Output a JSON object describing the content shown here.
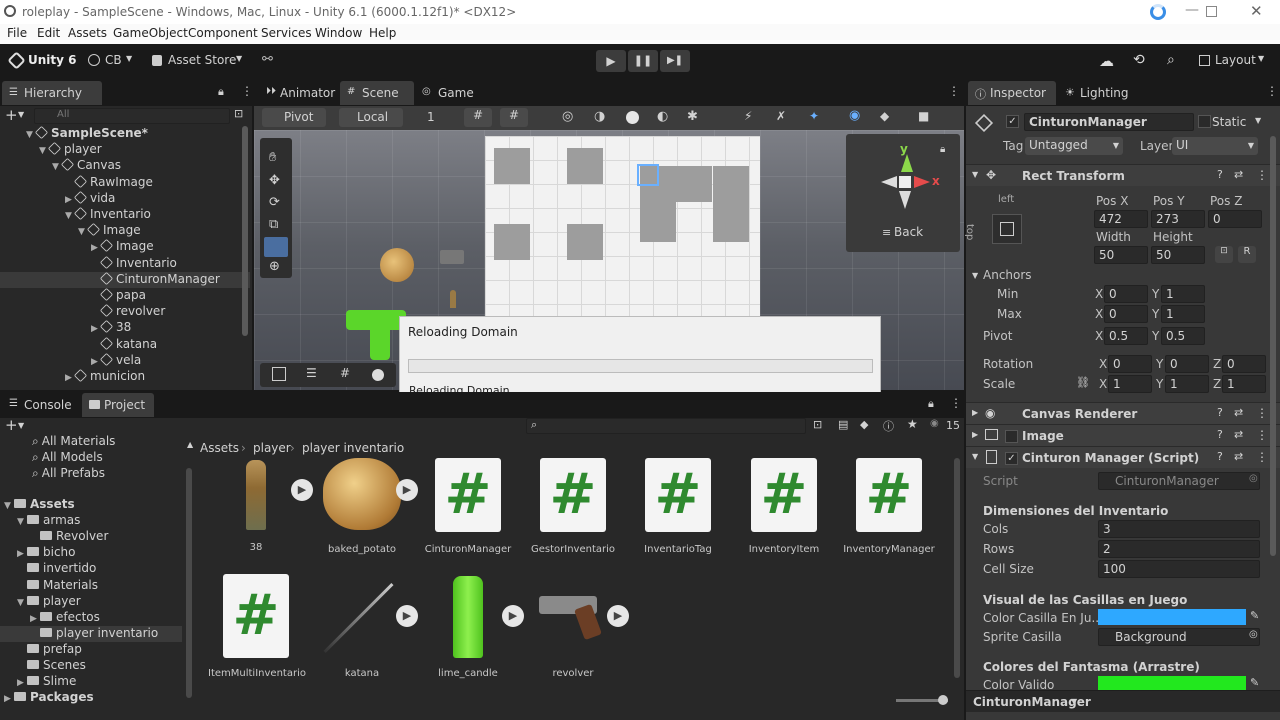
{
  "window": {
    "title": "roleplay - SampleScene - Windows, Mac, Linux - Unity 6.1 (6000.1.12f1)* <DX12>"
  },
  "menu": [
    "File",
    "Edit",
    "Assets",
    "GameObject",
    "Component",
    "Services",
    "Window",
    "Help"
  ],
  "toolbar": {
    "unity_label": "Unity 6",
    "account": "CB",
    "asset_store": "Asset Store",
    "layout": "Layout"
  },
  "hierarchy": {
    "tab": "Hierarchy",
    "search_placeholder": "All",
    "rows": [
      {
        "label": "SampleScene*",
        "indent": 0,
        "arrow": "▼"
      },
      {
        "label": "player",
        "indent": 1,
        "arrow": "▼"
      },
      {
        "label": "Canvas",
        "indent": 2,
        "arrow": "▼"
      },
      {
        "label": "RawImage",
        "indent": 3,
        "arrow": ""
      },
      {
        "label": "vida",
        "indent": 3,
        "arrow": "▶"
      },
      {
        "label": "Inventario",
        "indent": 3,
        "arrow": "▼"
      },
      {
        "label": "Image",
        "indent": 4,
        "arrow": "▼"
      },
      {
        "label": "Image",
        "indent": 5,
        "arrow": "▶"
      },
      {
        "label": "Inventario",
        "indent": 5,
        "arrow": ""
      },
      {
        "label": "CinturonManager",
        "indent": 5,
        "arrow": ""
      },
      {
        "label": "papa",
        "indent": 5,
        "arrow": ""
      },
      {
        "label": "revolver",
        "indent": 5,
        "arrow": ""
      },
      {
        "label": "38",
        "indent": 5,
        "arrow": "▶"
      },
      {
        "label": "katana",
        "indent": 5,
        "arrow": ""
      },
      {
        "label": "vela",
        "indent": 5,
        "arrow": "▶"
      },
      {
        "label": "municion",
        "indent": 3,
        "arrow": "▶"
      }
    ]
  },
  "center_tabs": {
    "animator": "Animator",
    "scene": "Scene",
    "game": "Game"
  },
  "scene_toolbar": {
    "pivot": "Pivot",
    "local": "Local",
    "snap": "1"
  },
  "gizmo": {
    "back": "Back",
    "y": "y",
    "x": "x"
  },
  "dialog": {
    "title": "Reloading Domain",
    "message": "Reloading Domain",
    "progress": 0
  },
  "bottom_tabs": {
    "console": "Console",
    "project": "Project"
  },
  "project": {
    "favorites": [
      "All Materials",
      "All Models",
      "All Prefabs"
    ],
    "tree": [
      {
        "label": "Assets",
        "indent": 0,
        "arrow": "▼"
      },
      {
        "label": "armas",
        "indent": 1,
        "arrow": "▼"
      },
      {
        "label": "Revolver",
        "indent": 2,
        "arrow": ""
      },
      {
        "label": "bicho",
        "indent": 1,
        "arrow": "▶"
      },
      {
        "label": "invertido",
        "indent": 1,
        "arrow": ""
      },
      {
        "label": "Materials",
        "indent": 1,
        "arrow": ""
      },
      {
        "label": "player",
        "indent": 1,
        "arrow": "▼"
      },
      {
        "label": "efectos",
        "indent": 2,
        "arrow": "▶"
      },
      {
        "label": "player inventario",
        "indent": 2,
        "arrow": ""
      },
      {
        "label": "prefap",
        "indent": 1,
        "arrow": ""
      },
      {
        "label": "Scenes",
        "indent": 1,
        "arrow": ""
      },
      {
        "label": "Slime",
        "indent": 1,
        "arrow": "▶"
      },
      {
        "label": "Packages",
        "indent": 0,
        "arrow": "▶"
      }
    ],
    "breadcrumb": [
      "Assets",
      "player",
      "player inventario"
    ],
    "count": "15",
    "assets_row1": [
      "38",
      "baked_potato",
      "CinturonManager",
      "GestorInventario",
      "InventarioTag",
      "InventoryItem",
      "InventoryManager"
    ],
    "assets_row2": [
      "ItemMultiInventario",
      "katana",
      "lime_candle",
      "revolver"
    ]
  },
  "inspector": {
    "tab": "Inspector",
    "lighting_tab": "Lighting",
    "object_name": "CinturonManager",
    "static": "Static",
    "tag_label": "Tag",
    "tag": "Untagged",
    "layer_label": "Layer",
    "layer": "UI",
    "rect_transform": "Rect Transform",
    "anchor_preset": "left",
    "anchor_preset_side": "top",
    "posx_label": "Pos X",
    "posy_label": "Pos Y",
    "posz_label": "Pos Z",
    "posx": "472",
    "posy": "273",
    "posz": "0",
    "width_label": "Width",
    "height_label": "Height",
    "width": "50",
    "height": "50",
    "anchors": "Anchors",
    "min": "Min",
    "min_x": "0",
    "min_y": "1",
    "max": "Max",
    "max_x": "0",
    "max_y": "1",
    "pivot": "Pivot",
    "pivot_x": "0.5",
    "pivot_y": "0.5",
    "rotation": "Rotation",
    "rot_x": "0",
    "rot_y": "0",
    "rot_z": "0",
    "scale": "Scale",
    "scale_x": "1",
    "scale_y": "1",
    "scale_z": "1",
    "canvas_renderer": "Canvas Renderer",
    "image": "Image",
    "script_component": "Cinturon Manager (Script)",
    "script_label": "Script",
    "script_value": "CinturonManager",
    "dims_header": "Dimensiones del Inventario",
    "cols_label": "Cols",
    "cols": "3",
    "rows_label": "Rows",
    "rows": "2",
    "cellsize_label": "Cell Size",
    "cellsize": "100",
    "visual_header": "Visual de las Casillas en Juego",
    "color_casilla_label": "Color Casilla En Ju...",
    "sprite_label": "Sprite Casilla",
    "sprite": "Background",
    "ghost_header": "Colores del Fantasma (Arrastre)",
    "color_valido_label": "Color Valido",
    "footer": "CinturonManager",
    "colors": {
      "casilla": "#2ea8ff",
      "valido": "#22e81e"
    },
    "axis_x": "X",
    "axis_y": "Y",
    "axis_z": "Z"
  }
}
